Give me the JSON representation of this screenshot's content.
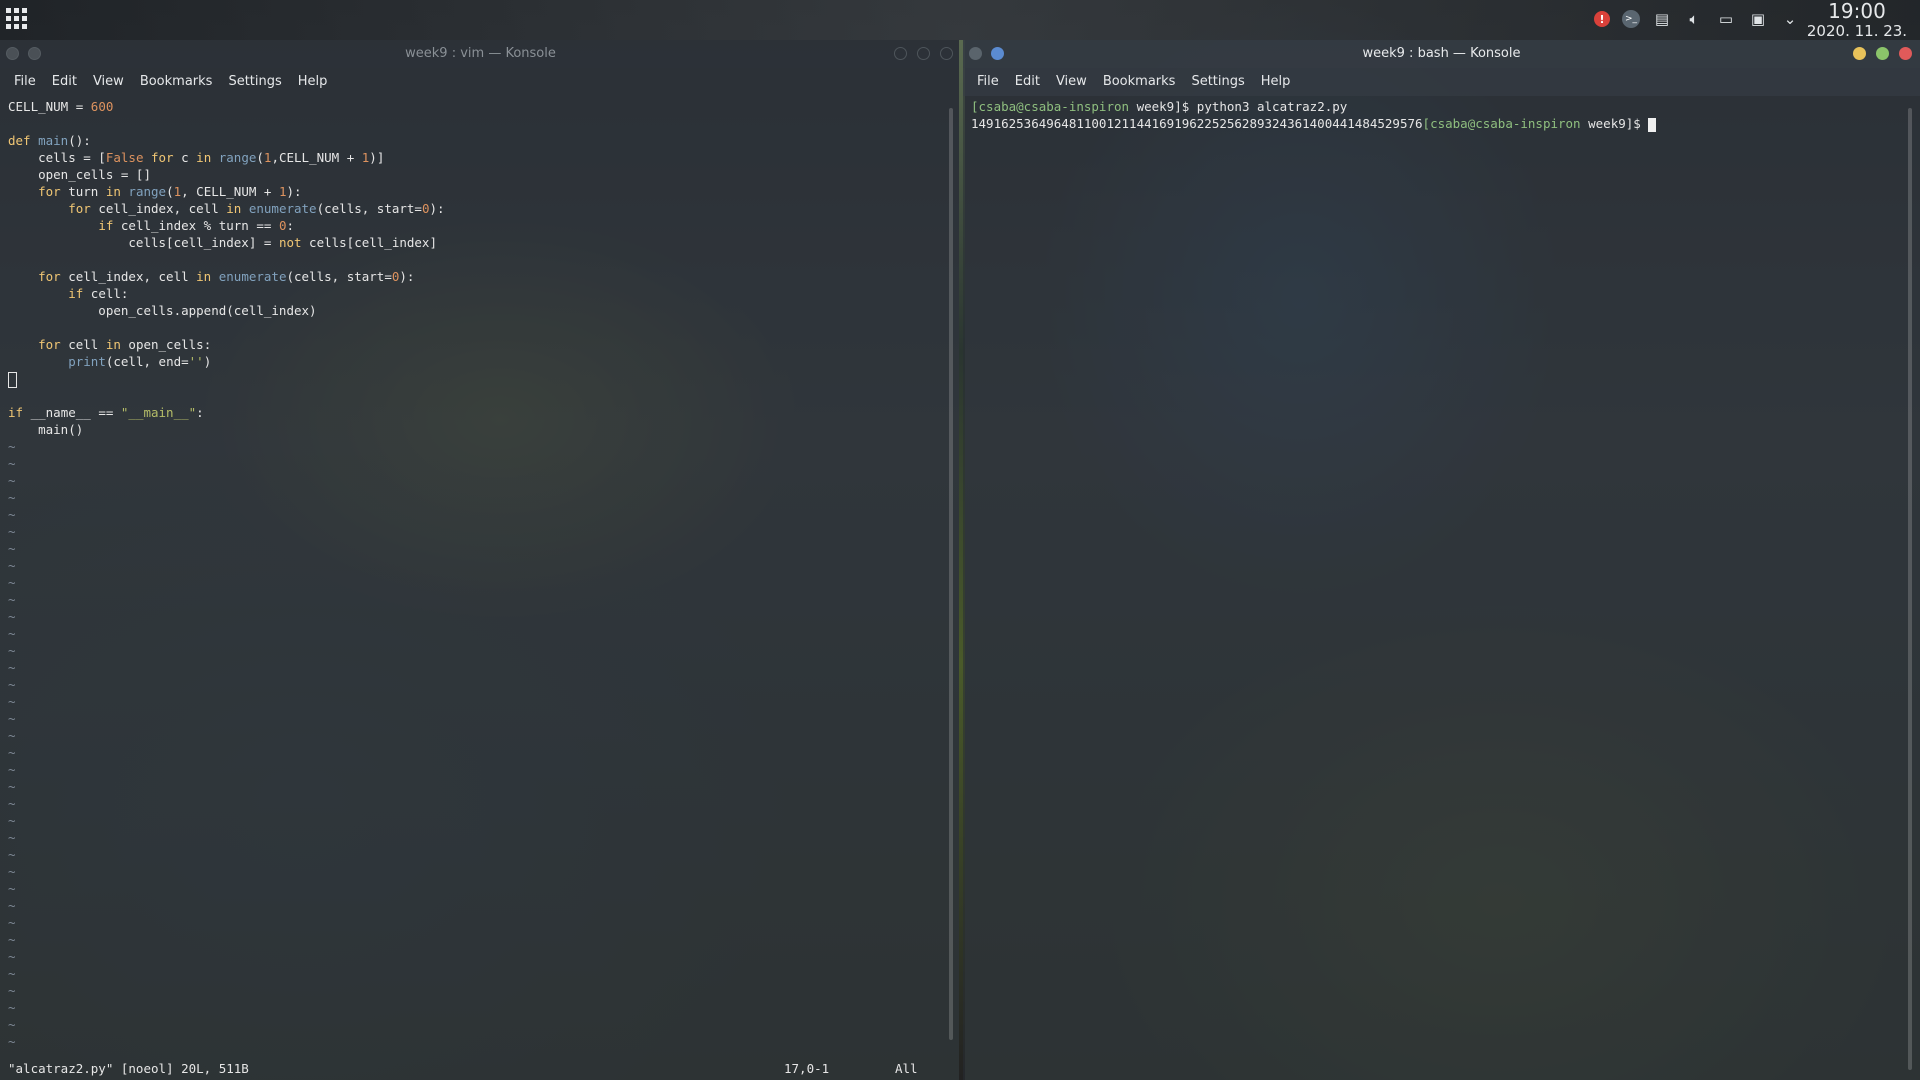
{
  "panel": {
    "clock_time": "19:00",
    "clock_date": "2020. 11. 23.",
    "tray_icons": [
      "alert-icon",
      "terminal-icon",
      "clipboard-icon",
      "volume-icon",
      "battery-icon",
      "display-icon",
      "chevron-down-icon"
    ]
  },
  "left_window": {
    "title": "week9 : vim — Konsole",
    "menu": [
      "File",
      "Edit",
      "View",
      "Bookmarks",
      "Settings",
      "Help"
    ],
    "status_file": "\"alcatraz2.py\" [noeol] 20L, 511B",
    "status_pos": "17,0-1",
    "status_scroll": "All"
  },
  "code": {
    "l1a": "CELL_NUM",
    "l1b": " = ",
    "l1c": "600",
    "l3a": "def",
    "l3b": " main",
    "l3c": "():",
    "l4a": "    cells = [",
    "l4b": "False",
    "l4c": " for",
    "l4d": " c ",
    "l4e": "in",
    "l4f": " range",
    "l4g": "(",
    "l4h": "1",
    "l4i": ",CELL_NUM + ",
    "l4j": "1",
    "l4k": ")]",
    "l5": "    open_cells = []",
    "l6a": "    ",
    "l6b": "for",
    "l6c": " turn ",
    "l6d": "in",
    "l6e": " range",
    "l6f": "(",
    "l6g": "1",
    "l6h": ", CELL_NUM + ",
    "l6i": "1",
    "l6j": "):",
    "l7a": "        ",
    "l7b": "for",
    "l7c": " cell_index, cell ",
    "l7d": "in",
    "l7e": " enumerate",
    "l7f": "(cells, start=",
    "l7g": "0",
    "l7h": "):",
    "l8a": "            ",
    "l8b": "if",
    "l8c": " cell_index % turn == ",
    "l8d": "0",
    "l8e": ":",
    "l9a": "                cells[cell_index] = ",
    "l9b": "not",
    "l9c": " cells[cell_index]",
    "l11a": "    ",
    "l11b": "for",
    "l11c": " cell_index, cell ",
    "l11d": "in",
    "l11e": " enumerate",
    "l11f": "(cells, start=",
    "l11g": "0",
    "l11h": "):",
    "l12a": "        ",
    "l12b": "if",
    "l12c": " cell:",
    "l13": "            open_cells.append(cell_index)",
    "l15a": "    ",
    "l15b": "for",
    "l15c": " cell ",
    "l15d": "in",
    "l15e": " open_cells:",
    "l16a": "        ",
    "l16b": "print",
    "l16c": "(cell, end=",
    "l16d": "''",
    "l16e": ")",
    "l19a": "if",
    "l19b": " __name__ == ",
    "l19c": "\"__main__\"",
    "l19d": ":",
    "l20": "    main()",
    "tilde": "~"
  },
  "right_window": {
    "title": "week9 : bash — Konsole",
    "menu": [
      "File",
      "Edit",
      "View",
      "Bookmarks",
      "Settings",
      "Help"
    ],
    "prompt": "[csaba@csaba-inspiron",
    "dir": " week9]$",
    "command": " python3 alcatraz2.py",
    "output": "149162536496481100121144169196225256289324361400441484529576",
    "prompt2": "[csaba@csaba-inspiron",
    "dir2": " week9]$"
  }
}
